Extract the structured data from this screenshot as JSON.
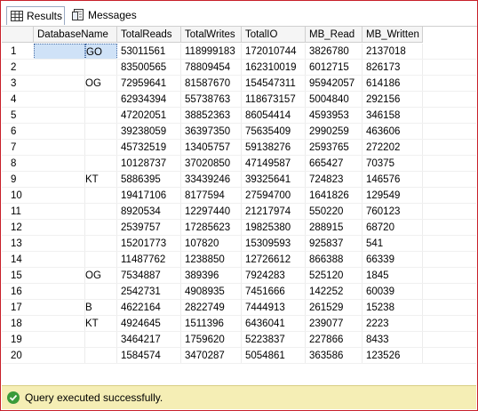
{
  "tabs": [
    {
      "label": "Results",
      "icon": "grid-icon",
      "active": true
    },
    {
      "label": "Messages",
      "icon": "messages-icon",
      "active": false
    }
  ],
  "columns": [
    "DatabaseName",
    "TotalReads",
    "TotalWrites",
    "TotalIO",
    "MB_Read",
    "MB_Written"
  ],
  "rows": [
    {
      "n": "1",
      "db": "GO",
      "reads": "53011561",
      "writes": "118999183",
      "io": "172010744",
      "mbr": "3826780",
      "mbw": "2137018"
    },
    {
      "n": "2",
      "db": "",
      "reads": "83500565",
      "writes": "78809454",
      "io": "162310019",
      "mbr": "6012715",
      "mbw": "826173"
    },
    {
      "n": "3",
      "db": "OG",
      "reads": "72959641",
      "writes": "81587670",
      "io": "154547311",
      "mbr": "95942057",
      "mbw": "614186"
    },
    {
      "n": "4",
      "db": "",
      "reads": "62934394",
      "writes": "55738763",
      "io": "118673157",
      "mbr": "5004840",
      "mbw": "292156"
    },
    {
      "n": "5",
      "db": "",
      "reads": "47202051",
      "writes": "38852363",
      "io": "86054414",
      "mbr": "4593953",
      "mbw": "346158"
    },
    {
      "n": "6",
      "db": "",
      "reads": "39238059",
      "writes": "36397350",
      "io": "75635409",
      "mbr": "2990259",
      "mbw": "463606"
    },
    {
      "n": "7",
      "db": "",
      "reads": "45732519",
      "writes": "13405757",
      "io": "59138276",
      "mbr": "2593765",
      "mbw": "272202"
    },
    {
      "n": "8",
      "db": "",
      "reads": "10128737",
      "writes": "37020850",
      "io": "47149587",
      "mbr": "665427",
      "mbw": "70375"
    },
    {
      "n": "9",
      "db": "KT",
      "reads": "5886395",
      "writes": "33439246",
      "io": "39325641",
      "mbr": "724823",
      "mbw": "146576"
    },
    {
      "n": "10",
      "db": "",
      "reads": "19417106",
      "writes": "8177594",
      "io": "27594700",
      "mbr": "1641826",
      "mbw": "129549"
    },
    {
      "n": "11",
      "db": "",
      "reads": "8920534",
      "writes": "12297440",
      "io": "21217974",
      "mbr": "550220",
      "mbw": "760123"
    },
    {
      "n": "12",
      "db": "",
      "reads": "2539757",
      "writes": "17285623",
      "io": "19825380",
      "mbr": "288915",
      "mbw": "68720"
    },
    {
      "n": "13",
      "db": "",
      "reads": "15201773",
      "writes": "107820",
      "io": "15309593",
      "mbr": "925837",
      "mbw": "541"
    },
    {
      "n": "14",
      "db": "",
      "reads": "11487762",
      "writes": "1238850",
      "io": "12726612",
      "mbr": "866388",
      "mbw": "66339"
    },
    {
      "n": "15",
      "db": "OG",
      "reads": "7534887",
      "writes": "389396",
      "io": "7924283",
      "mbr": "525120",
      "mbw": "1845"
    },
    {
      "n": "16",
      "db": "",
      "reads": "2542731",
      "writes": "4908935",
      "io": "7451666",
      "mbr": "142252",
      "mbw": "60039"
    },
    {
      "n": "17",
      "db": "B",
      "reads": "4622164",
      "writes": "2822749",
      "io": "7444913",
      "mbr": "261529",
      "mbw": "15238"
    },
    {
      "n": "18",
      "db": "KT",
      "reads": "4924645",
      "writes": "1511396",
      "io": "6436041",
      "mbr": "239077",
      "mbw": "2223"
    },
    {
      "n": "19",
      "db": "",
      "reads": "3464217",
      "writes": "1759620",
      "io": "5223837",
      "mbr": "227866",
      "mbw": "8433"
    },
    {
      "n": "20",
      "db": "",
      "reads": "1584574",
      "writes": "3470287",
      "io": "5054861",
      "mbr": "363586",
      "mbw": "123526"
    }
  ],
  "status": {
    "text": "Query executed successfully.",
    "icon": "success-check-icon",
    "color": "#f5eeb5"
  },
  "colors": {
    "accent_border": "#c8202a",
    "selection": "#cfe2f7"
  }
}
